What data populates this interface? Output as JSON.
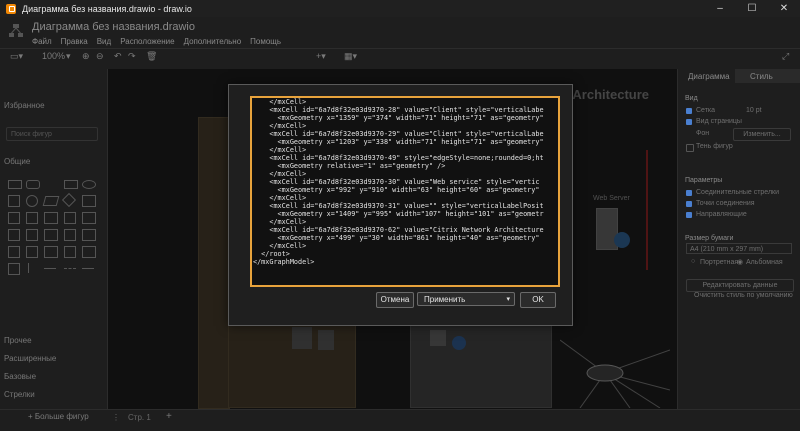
{
  "window": {
    "title": "Диаграмма без названия.drawio - draw.io",
    "controls": [
      "–",
      "☐",
      "✕"
    ]
  },
  "app": {
    "doc_name": "Диаграмма без названия.drawio",
    "menu": [
      "Файл",
      "Правка",
      "Вид",
      "Расположение",
      "Дополнительно",
      "Помощь"
    ],
    "zoom": "100%"
  },
  "sidebar": {
    "search_placeholder": "Поиск фигур",
    "favorites": "Избранное",
    "general": "Общие",
    "sections": [
      "Прочее",
      "Расширенные",
      "Базовые",
      "Стрелки"
    ],
    "more_shapes": "+ Больше фигур"
  },
  "canvas": {
    "title_fragment": "rk Architecture",
    "web_server_label": "Web Server"
  },
  "right_panel": {
    "tabs": [
      "Диаграмма",
      "Стиль"
    ],
    "view_heading": "Вид",
    "grid_label": "Сетка",
    "grid_size": "10 pt",
    "page_view_label": "Вид страницы",
    "background_label": "Фон",
    "edit_button": "Изменить...",
    "shadow_label": "Тень фигур",
    "options_heading": "Параметры",
    "option1": "Соединительные стрелки",
    "option2": "Точки соединения",
    "option3": "Направляющие",
    "paper_heading": "Размер бумаги",
    "paper_value": "A4 (210 mm x 297 mm)",
    "portrait": "Портретная",
    "landscape": "Альбомная",
    "edit_data_button": "Редактировать данные",
    "clear_style_link": "Очистить стиль по умолчанию"
  },
  "bottom": {
    "page_tab": "Стр. 1",
    "add_page": "+"
  },
  "dialog": {
    "xml_lines": [
      "    </mxCell>",
      "    <mxCell id=\"6a7d8f32e03d9370-28\" value=\"Client\" style=\"verticalLabe",
      "      <mxGeometry x=\"1359\" y=\"374\" width=\"71\" height=\"71\" as=\"geometry\"",
      "    </mxCell>",
      "    <mxCell id=\"6a7d8f32e03d9370-29\" value=\"Client\" style=\"verticalLabe",
      "      <mxGeometry x=\"1203\" y=\"338\" width=\"71\" height=\"71\" as=\"geometry\"",
      "    </mxCell>",
      "    <mxCell id=\"6a7d8f32e03d9370-49\" style=\"edgeStyle=none;rounded=0;ht",
      "      <mxGeometry relative=\"1\" as=\"geometry\" />",
      "    </mxCell>",
      "    <mxCell id=\"6a7d8f32e03d9370-30\" value=\"Web service\" style=\"vertic",
      "      <mxGeometry x=\"992\" y=\"910\" width=\"63\" height=\"60\" as=\"geometry\"",
      "    </mxCell>",
      "    <mxCell id=\"6a7d8f32e03d9370-31\" value=\"\" style=\"verticalLabelPosit",
      "      <mxGeometry x=\"1409\" y=\"995\" width=\"107\" height=\"101\" as=\"geometr",
      "    </mxCell>",
      "    <mxCell id=\"6a7d8f32e03d9370-62\" value=\"Citrix Network Architecture",
      "      <mxGeometry x=\"499\" y=\"30\" width=\"861\" height=\"40\" as=\"geometry\"",
      "    </mxCell>",
      "  </root>",
      "</mxGraphModel>"
    ],
    "cancel_label": "Отмена",
    "apply_select": "Применить",
    "ok_label": "OK"
  },
  "colors": {
    "accent": "#e8a33c",
    "drawio_orange": "#f08705"
  }
}
